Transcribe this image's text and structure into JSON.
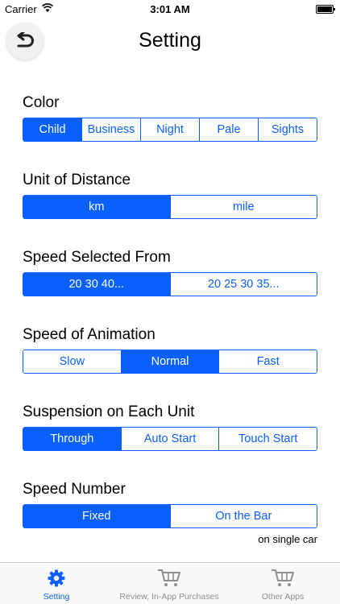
{
  "status_bar": {
    "carrier": "Carrier",
    "time": "3:01 AM"
  },
  "header": {
    "title": "Setting",
    "back_icon": "back-arrow-icon"
  },
  "colors": {
    "accent": "#0a60ff",
    "inactive": "#8e8e93"
  },
  "sections": [
    {
      "label": "Color",
      "options": [
        "Child",
        "Business",
        "Night",
        "Pale",
        "Sights"
      ],
      "selected": 0
    },
    {
      "label": "Unit of Distance",
      "options": [
        "km",
        "mile"
      ],
      "selected": 0
    },
    {
      "label": "Speed Selected From",
      "options": [
        "20 30 40...",
        "20 25 30 35..."
      ],
      "selected": 0
    },
    {
      "label": "Speed of Animation",
      "options": [
        "Slow",
        "Normal",
        "Fast"
      ],
      "selected": 1
    },
    {
      "label": "Suspension on Each Unit",
      "options": [
        "Through",
        "Auto Start",
        "Touch Start"
      ],
      "selected": 0
    },
    {
      "label": "Speed Number",
      "options": [
        "Fixed",
        "On the Bar"
      ],
      "selected": 0,
      "note": "on single car"
    }
  ],
  "tab_bar": {
    "tabs": [
      {
        "label": "Setting",
        "icon": "gear-icon",
        "active": true
      },
      {
        "label": "Review, In-App Purchases",
        "icon": "cart-icon",
        "active": false
      },
      {
        "label": "Other Apps",
        "icon": "cart-icon",
        "active": false
      }
    ]
  }
}
